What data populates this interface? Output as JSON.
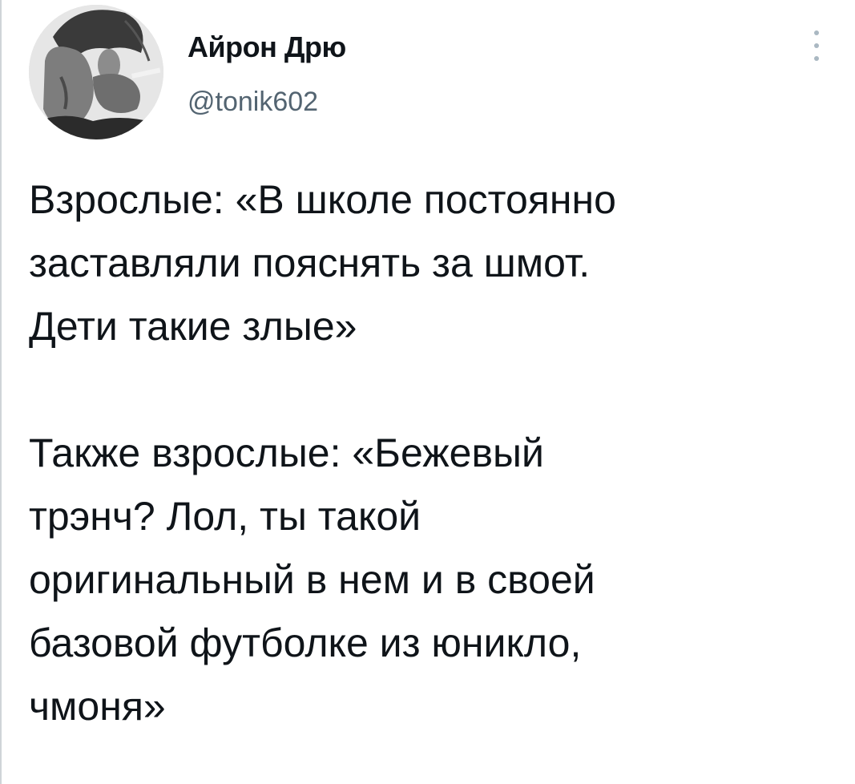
{
  "author": {
    "display_name": "Айрон Дрю",
    "handle": "@tonik602",
    "avatar_alt": "avatar"
  },
  "menu": {
    "icon": "more-vertical-icon"
  },
  "tweet": {
    "paragraphs": [
      {
        "lines": [
          "Взрослые: «В школе постоянно",
          "заставляли пояснять за шмот.",
          "Дети такие злые»"
        ]
      },
      {
        "lines": [
          "Также взрослые: «Бежевый",
          "трэнч? Лол, ты такой",
          "оригинальный в нем и в своей",
          "базовой футболке из юникло,",
          "чмоня»"
        ]
      }
    ]
  },
  "colors": {
    "text": "#0f1419",
    "secondary": "#536471",
    "menu_dots": "#aab8c2"
  }
}
